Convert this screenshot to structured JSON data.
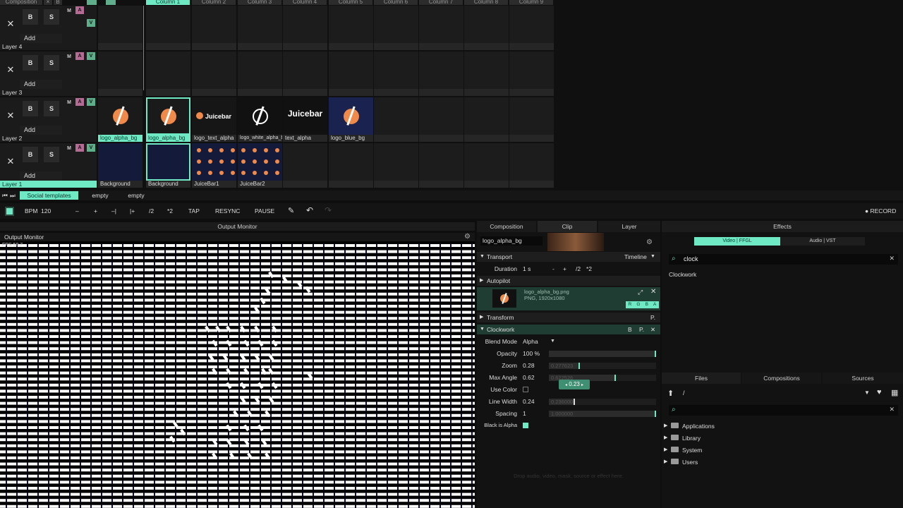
{
  "columns": [
    "Composition",
    "Column 1",
    "Column 2",
    "Column 3",
    "Column 4",
    "Column 5",
    "Column 6",
    "Column 7",
    "Column 8",
    "Column 9"
  ],
  "layers": [
    {
      "name": "Layer 4",
      "b": "B",
      "s": "S",
      "add": "Add",
      "m": "M",
      "a": "A",
      "v": "V",
      "clips": []
    },
    {
      "name": "Layer 3",
      "b": "B",
      "s": "S",
      "add": "Add",
      "m": "M",
      "a": "A",
      "v": "V",
      "clips": []
    },
    {
      "name": "Layer 2",
      "b": "B",
      "s": "S",
      "add": "Add",
      "m": "M",
      "a": "A",
      "v": "V",
      "clips": [
        {
          "label": "logo_alpha_bg",
          "thumb": "logo"
        },
        {
          "label": "logo_alpha_bg",
          "thumb": "logo"
        },
        {
          "label": "logo_text_alpha",
          "thumb": "Juicebar"
        },
        {
          "label": "logo_white_alpha_bg",
          "thumb": "logo-white"
        },
        {
          "label": "text_alpha",
          "thumb": "Juicebar"
        },
        {
          "label": "logo_blue_bg",
          "thumb": "logo"
        }
      ]
    },
    {
      "name": "Layer 1",
      "b": "B",
      "s": "S",
      "add": "Add",
      "m": "M",
      "a": "A",
      "v": "V",
      "clips": [
        {
          "label": "Background",
          "thumb": "bg"
        },
        {
          "label": "Background",
          "thumb": "bg"
        },
        {
          "label": "JuiceBar1",
          "thumb": "grid"
        },
        {
          "label": "JuiceBar2",
          "thumb": "grid"
        }
      ]
    }
  ],
  "decks": [
    "Social templates",
    "empty",
    "empty"
  ],
  "toolbar": {
    "bpm_label": "BPM",
    "bpm_value": "120",
    "minus": "–",
    "plus": "+",
    "nudge_minus": "–|",
    "nudge_plus": "|+",
    "half": "/2",
    "double": "*2",
    "tap": "TAP",
    "resync": "RESYNC",
    "pause": "PAUSE",
    "record": "● RECORD"
  },
  "output_monitor": {
    "header": "Output Monitor",
    "title": "Output Monitor",
    "fps": "FPS 59.7"
  },
  "panel": {
    "tabs": [
      "Composition",
      "Clip",
      "Layer"
    ],
    "clip_name": "logo_alpha_bg",
    "transport": {
      "label": "Transport",
      "mode": "Timeline",
      "duration_label": "Duration",
      "duration_value": "1 s",
      "minus": "-",
      "plus": "+",
      "half": "/2",
      "double": "*2"
    },
    "autopilot": "Autopilot",
    "source": {
      "filename": "logo_alpha_bg.png",
      "info": "PNG, 1920x1080",
      "r": "R",
      "g": "G",
      "b": "B",
      "a": "A"
    },
    "transform": "Transform",
    "transform_p": "P.",
    "effect": {
      "name": "Clockwork",
      "b": "B",
      "p": "P."
    },
    "params": [
      {
        "label": "Blend Mode",
        "value": "Alpha"
      },
      {
        "label": "Opacity",
        "value": "100 %",
        "fraction": 1.0
      },
      {
        "label": "Zoom",
        "value": "0.28",
        "ghost": "0.277623",
        "fraction": 0.28
      },
      {
        "label": "Max Angle",
        "value": "0.62",
        "ghost": "0.622526",
        "fraction": 0.62
      },
      {
        "label": "Use Color",
        "checked": false
      },
      {
        "label": "Line Width",
        "value": "0.24",
        "ghost": "0.236000",
        "fraction": 0.24
      },
      {
        "label": "Spacing",
        "value": "1",
        "ghost": "1.000000",
        "fraction": 1.0
      },
      {
        "label": "Black is Alpha",
        "checked": true
      }
    ],
    "tooltip": "0.23",
    "dropzone": "Drop audio, video, mask, source or effect here."
  },
  "effects": {
    "header": "Effects",
    "tabs": [
      "Video | FFGL",
      "Audio | VST"
    ],
    "search_value": "clock",
    "results": [
      "Clockwork"
    ]
  },
  "files": {
    "tabs": [
      "Files",
      "Compositions",
      "Sources"
    ],
    "path": "/",
    "search_placeholder": "",
    "folders": [
      "Applications",
      "Library",
      "System",
      "Users"
    ]
  },
  "colors": {
    "accent": "#6fe8c4",
    "a_button": "#b46c94",
    "v_button": "#5fae8b",
    "thumb_orange": "#f08a4b",
    "bg_navy": "#141a3a"
  }
}
